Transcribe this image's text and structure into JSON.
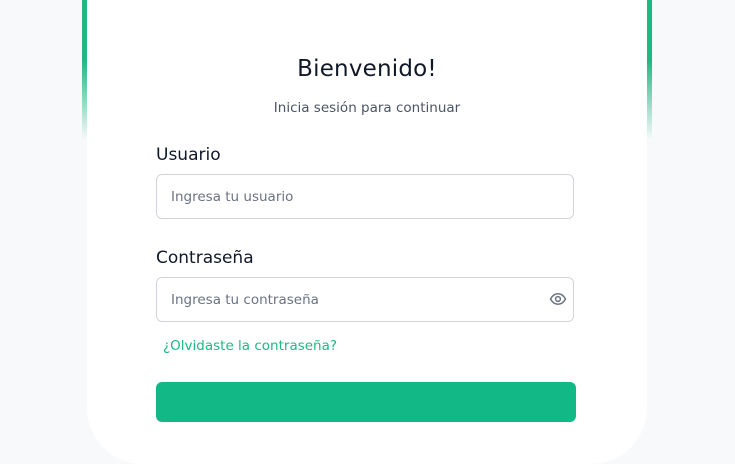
{
  "header": {
    "title": "Bienvenido!",
    "subtitle": "Inicia sesión para continuar"
  },
  "form": {
    "username": {
      "label": "Usuario",
      "placeholder": "Ingresa tu usuario",
      "value": ""
    },
    "password": {
      "label": "Contraseña",
      "placeholder": "Ingresa tu contraseña",
      "value": "",
      "toggle_icon": "eye-icon"
    },
    "forgot_link": "¿Olvidaste la contraseña?",
    "submit_label": ""
  },
  "colors": {
    "accent": "#1fb883",
    "page_background": "#f8f9fb",
    "card_background": "#ffffff"
  }
}
